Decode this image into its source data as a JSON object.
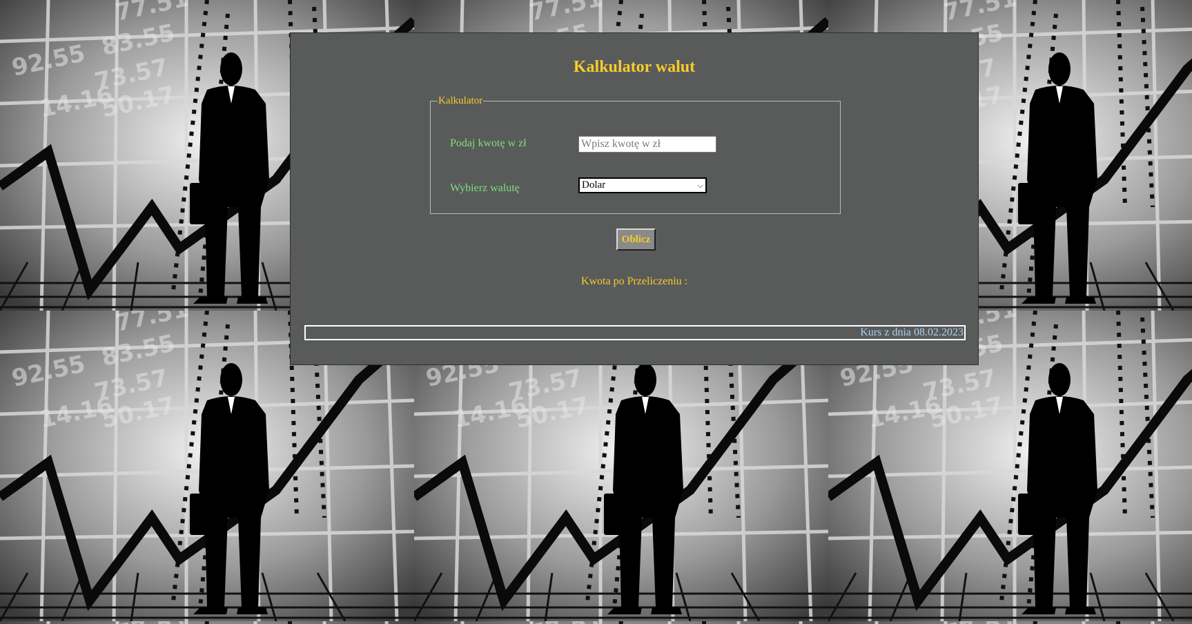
{
  "page": {
    "title": "Kalkulator walut"
  },
  "calculator": {
    "legend": "Kalkulator",
    "amount_label": "Podaj kwotę w zł",
    "amount_placeholder": "Wpisz kwotę w zł",
    "amount_value": "",
    "currency_label": "Wybierz walutę",
    "currency_selected": "Dolar"
  },
  "actions": {
    "calculate_label": "Oblicz"
  },
  "result": {
    "label": "Kwota po Przeliczeniu :"
  },
  "footer": {
    "rate_date_text": "Kurs z dnia 08.02.2023"
  },
  "colors": {
    "panel_background": "#595a5a",
    "title_yellow": "#f6cd2b",
    "label_green": "#7de07a",
    "rate_text_blue": "#a7d2ee"
  },
  "icons": {
    "select_arrow": "chevron-down-icon"
  }
}
